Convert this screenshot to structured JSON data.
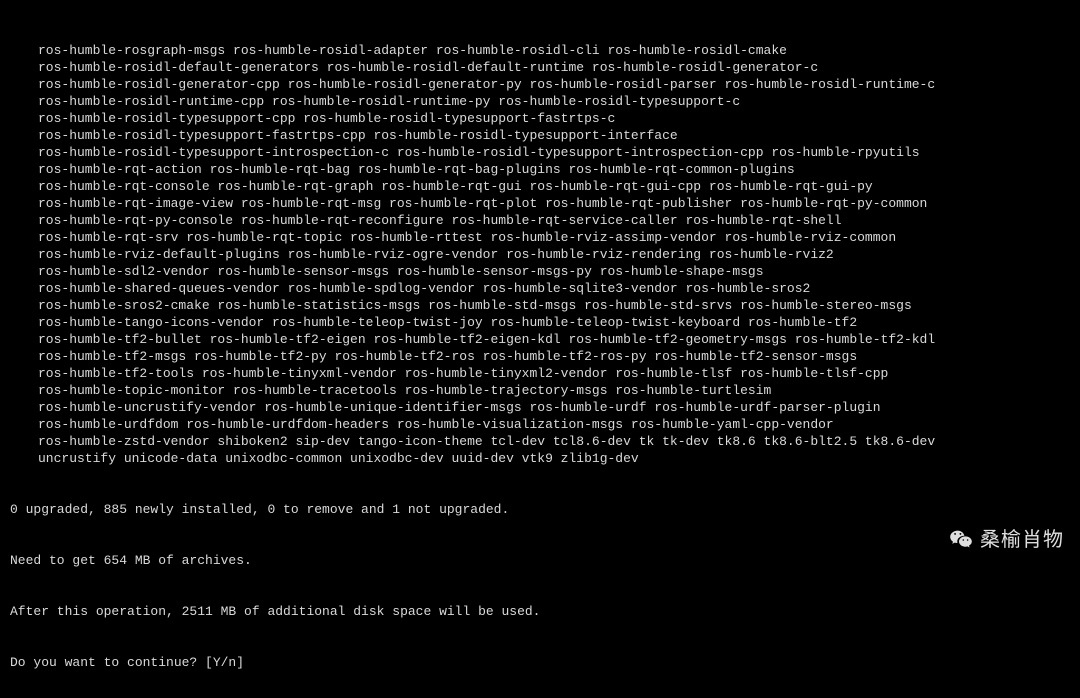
{
  "packages_lines": [
    "ros-humble-rosgraph-msgs ros-humble-rosidl-adapter ros-humble-rosidl-cli ros-humble-rosidl-cmake",
    "ros-humble-rosidl-default-generators ros-humble-rosidl-default-runtime ros-humble-rosidl-generator-c",
    "ros-humble-rosidl-generator-cpp ros-humble-rosidl-generator-py ros-humble-rosidl-parser ros-humble-rosidl-runtime-c",
    "ros-humble-rosidl-runtime-cpp ros-humble-rosidl-runtime-py ros-humble-rosidl-typesupport-c",
    "ros-humble-rosidl-typesupport-cpp ros-humble-rosidl-typesupport-fastrtps-c",
    "ros-humble-rosidl-typesupport-fastrtps-cpp ros-humble-rosidl-typesupport-interface",
    "ros-humble-rosidl-typesupport-introspection-c ros-humble-rosidl-typesupport-introspection-cpp ros-humble-rpyutils",
    "ros-humble-rqt-action ros-humble-rqt-bag ros-humble-rqt-bag-plugins ros-humble-rqt-common-plugins",
    "ros-humble-rqt-console ros-humble-rqt-graph ros-humble-rqt-gui ros-humble-rqt-gui-cpp ros-humble-rqt-gui-py",
    "ros-humble-rqt-image-view ros-humble-rqt-msg ros-humble-rqt-plot ros-humble-rqt-publisher ros-humble-rqt-py-common",
    "ros-humble-rqt-py-console ros-humble-rqt-reconfigure ros-humble-rqt-service-caller ros-humble-rqt-shell",
    "ros-humble-rqt-srv ros-humble-rqt-topic ros-humble-rttest ros-humble-rviz-assimp-vendor ros-humble-rviz-common",
    "ros-humble-rviz-default-plugins ros-humble-rviz-ogre-vendor ros-humble-rviz-rendering ros-humble-rviz2",
    "ros-humble-sdl2-vendor ros-humble-sensor-msgs ros-humble-sensor-msgs-py ros-humble-shape-msgs",
    "ros-humble-shared-queues-vendor ros-humble-spdlog-vendor ros-humble-sqlite3-vendor ros-humble-sros2",
    "ros-humble-sros2-cmake ros-humble-statistics-msgs ros-humble-std-msgs ros-humble-std-srvs ros-humble-stereo-msgs",
    "ros-humble-tango-icons-vendor ros-humble-teleop-twist-joy ros-humble-teleop-twist-keyboard ros-humble-tf2",
    "ros-humble-tf2-bullet ros-humble-tf2-eigen ros-humble-tf2-eigen-kdl ros-humble-tf2-geometry-msgs ros-humble-tf2-kdl",
    "ros-humble-tf2-msgs ros-humble-tf2-py ros-humble-tf2-ros ros-humble-tf2-ros-py ros-humble-tf2-sensor-msgs",
    "ros-humble-tf2-tools ros-humble-tinyxml-vendor ros-humble-tinyxml2-vendor ros-humble-tlsf ros-humble-tlsf-cpp",
    "ros-humble-topic-monitor ros-humble-tracetools ros-humble-trajectory-msgs ros-humble-turtlesim",
    "ros-humble-uncrustify-vendor ros-humble-unique-identifier-msgs ros-humble-urdf ros-humble-urdf-parser-plugin",
    "ros-humble-urdfdom ros-humble-urdfdom-headers ros-humble-visualization-msgs ros-humble-yaml-cpp-vendor",
    "ros-humble-zstd-vendor shiboken2 sip-dev tango-icon-theme tcl-dev tcl8.6-dev tk tk-dev tk8.6 tk8.6-blt2.5 tk8.6-dev",
    "uncrustify unicode-data unixodbc-common unixodbc-dev uuid-dev vtk9 zlib1g-dev"
  ],
  "summary": {
    "upgrade_line": "0 upgraded, 885 newly installed, 0 to remove and 1 not upgraded.",
    "need_get": "Need to get 654 MB of archives.",
    "after_op": "After this operation, 2511 MB of additional disk space will be used.",
    "prompt": "Do you want to continue? [Y/n]"
  },
  "watermark": {
    "text": "桑榆肖物"
  }
}
